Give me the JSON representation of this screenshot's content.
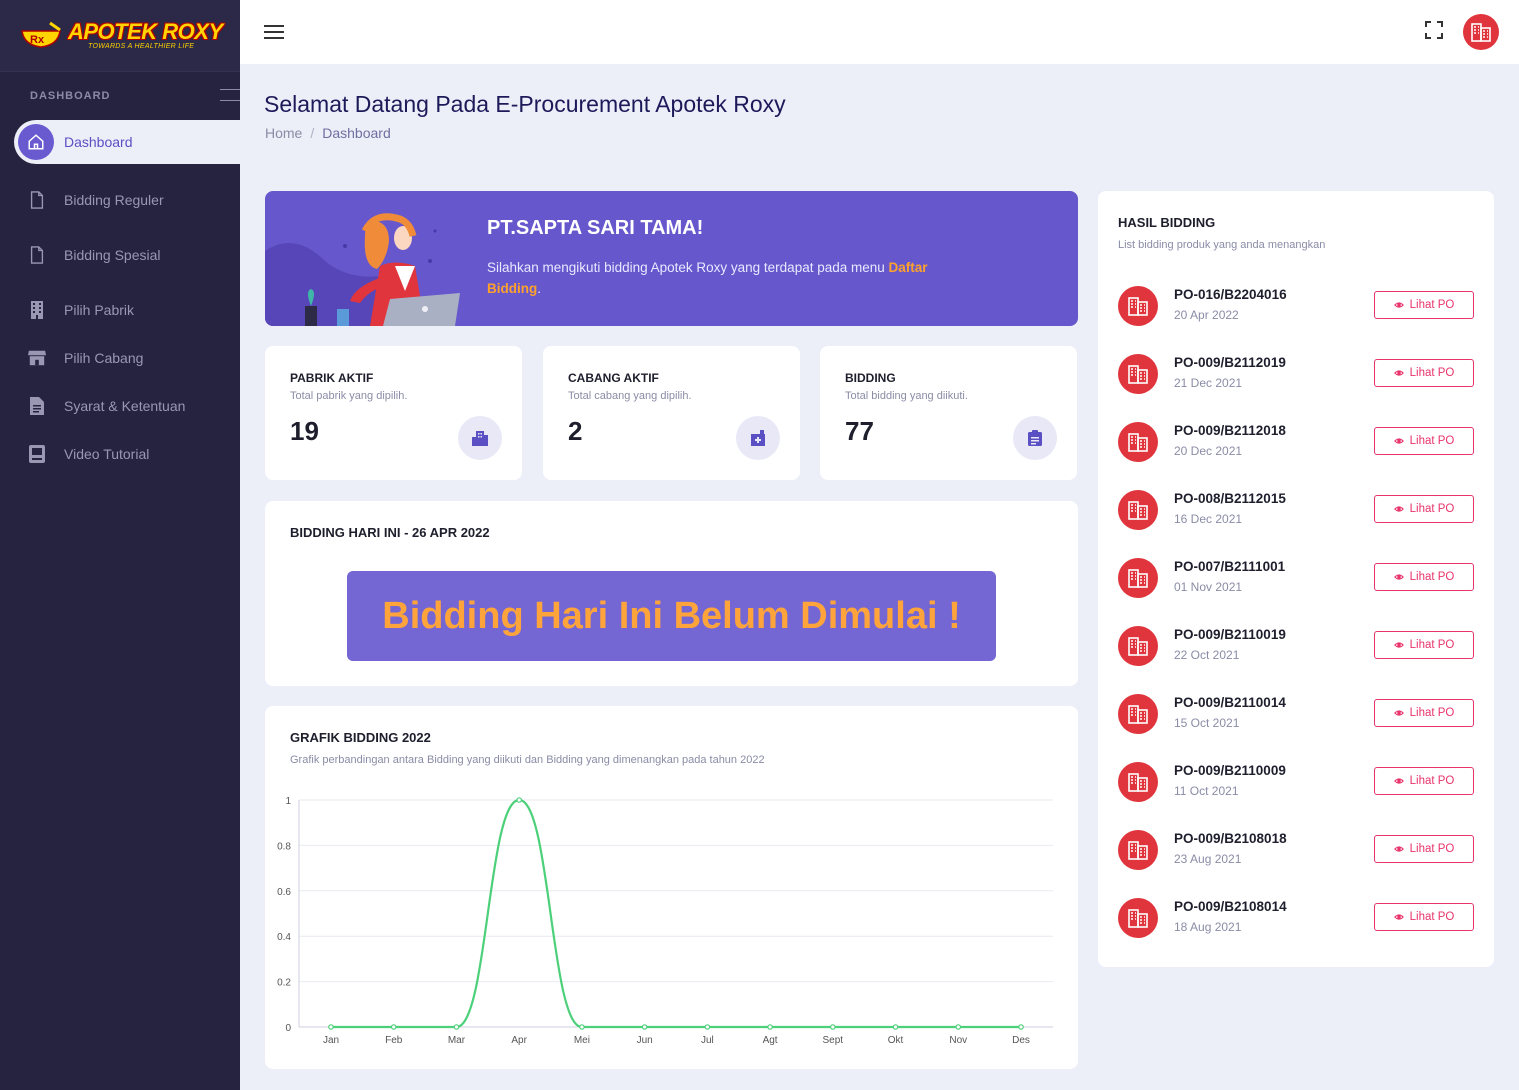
{
  "brand": {
    "name": "APOTEK ROXY",
    "tagline": "TOWARDS A HEALTHIER LIFE"
  },
  "sidebar": {
    "section_title": "DASHBOARD",
    "items": [
      {
        "label": "Dashboard",
        "icon": "home-icon",
        "active": true
      },
      {
        "label": "Bidding Reguler",
        "icon": "file-icon"
      },
      {
        "label": "Bidding Spesial",
        "icon": "file-icon"
      },
      {
        "label": "Pilih Pabrik",
        "icon": "building-icon"
      },
      {
        "label": "Pilih Cabang",
        "icon": "store-icon"
      },
      {
        "label": "Syarat & Ketentuan",
        "icon": "document-icon"
      },
      {
        "label": "Video Tutorial",
        "icon": "book-icon"
      }
    ]
  },
  "header": {
    "title": "Selamat Datang Pada E-Procurement Apotek Roxy",
    "breadcrumb": {
      "home": "Home",
      "separator": "/",
      "current": "Dashboard"
    }
  },
  "banner": {
    "title": "PT.SAPTA SARI TAMA!",
    "text": "Silahkan mengikuti bidding Apotek Roxy yang terdapat pada menu ",
    "highlight": "Daftar Bidding",
    "suffix": "."
  },
  "stats": [
    {
      "title": "PABRIK AKTIF",
      "subtitle": "Total pabrik yang dipilih.",
      "value": "19",
      "icon": "building-icon"
    },
    {
      "title": "CABANG AKTIF",
      "subtitle": "Total cabang yang dipilih.",
      "value": "2",
      "icon": "hospital-icon"
    },
    {
      "title": "BIDDING",
      "subtitle": "Total bidding yang diikuti.",
      "value": "77",
      "icon": "clipboard-icon"
    }
  ],
  "today": {
    "title": "BIDDING HARI INI - 26 APR 2022",
    "message": "Bidding Hari Ini Belum Dimulai !"
  },
  "graph": {
    "title": "GRAFIK BIDDING 2022",
    "subtitle": "Grafik perbandingan antara Bidding yang diikuti dan Bidding yang dimenangkan pada tahun 2022"
  },
  "chart_data": {
    "type": "line",
    "categories": [
      "Jan",
      "Feb",
      "Mar",
      "Apr",
      "Mei",
      "Jun",
      "Jul",
      "Agt",
      "Sept",
      "Okt",
      "Nov",
      "Des"
    ],
    "series": [
      {
        "values": [
          0,
          0,
          0,
          1,
          0,
          0,
          0,
          0,
          0,
          0,
          0,
          0
        ],
        "color": "#4cd07a"
      }
    ],
    "ylim": [
      0,
      1
    ],
    "yticks": [
      "0",
      "0.2",
      "0.4",
      "0.6",
      "0.8",
      "1"
    ],
    "grid": true
  },
  "hasil": {
    "title": "HASIL BIDDING",
    "subtitle": "List bidding produk yang anda menangkan",
    "button_label": "Lihat PO",
    "items": [
      {
        "code": "PO-016/B2204016",
        "date": "20 Apr 2022"
      },
      {
        "code": "PO-009/B2112019",
        "date": "21 Dec 2021"
      },
      {
        "code": "PO-009/B2112018",
        "date": "20 Dec 2021"
      },
      {
        "code": "PO-008/B2112015",
        "date": "16 Dec 2021"
      },
      {
        "code": "PO-007/B2111001",
        "date": "01 Nov 2021"
      },
      {
        "code": "PO-009/B2110019",
        "date": "22 Oct 2021"
      },
      {
        "code": "PO-009/B2110014",
        "date": "15 Oct 2021"
      },
      {
        "code": "PO-009/B2110009",
        "date": "11 Oct 2021"
      },
      {
        "code": "PO-009/B2108018",
        "date": "23 Aug 2021"
      },
      {
        "code": "PO-009/B2108014",
        "date": "18 Aug 2021"
      }
    ]
  },
  "colors": {
    "primary": "#6657cc",
    "accent": "#ffa22b",
    "danger": "#e0353c",
    "sidebar": "#262340",
    "line": "#4cd07a"
  }
}
